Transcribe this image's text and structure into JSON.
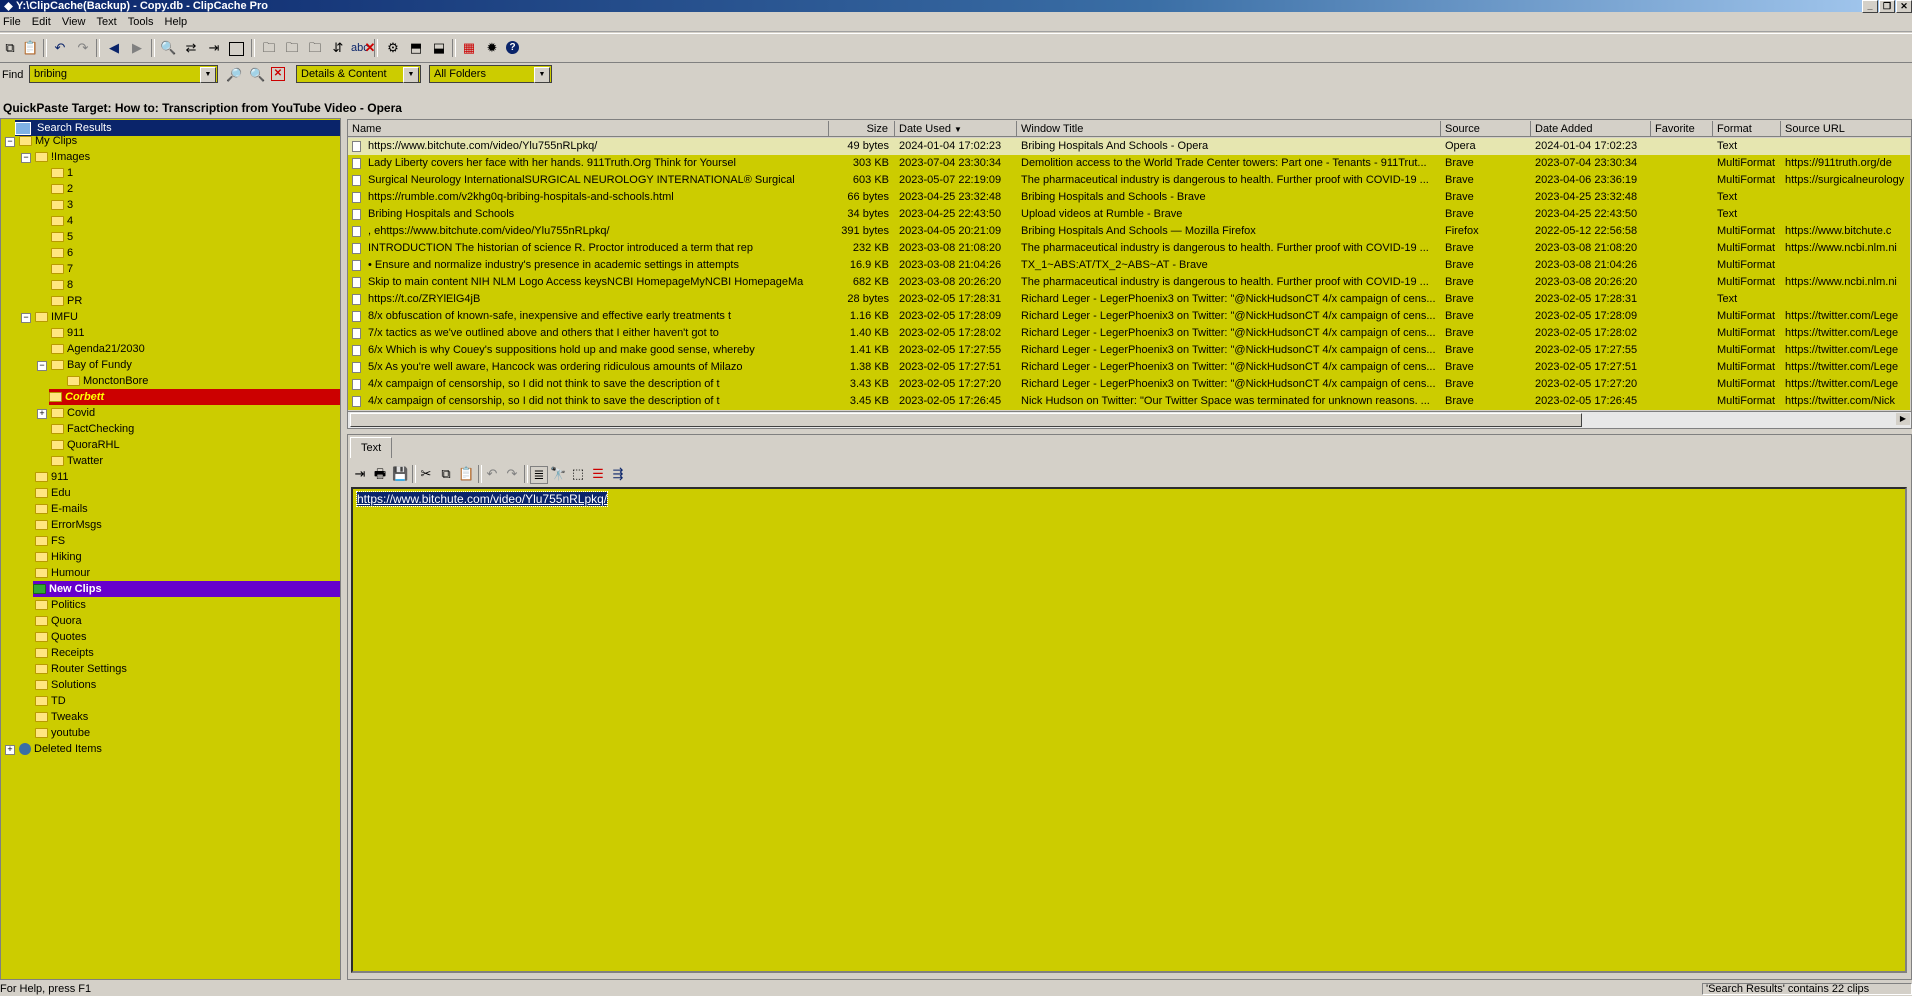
{
  "window": {
    "title": "Y:\\ClipCache(Backup) - Copy.db - ClipCache Pro",
    "controls": [
      "_",
      "❐",
      "✕"
    ]
  },
  "menu": [
    "File",
    "Edit",
    "View",
    "Text",
    "Tools",
    "Help"
  ],
  "find": {
    "label": "Find",
    "query": "bribing",
    "mode": "Details & Content",
    "folder": "All Folders"
  },
  "quickpaste": "QuickPaste Target: How to: Transcription from YouTube Video - Opera",
  "tree": {
    "search_results": "Search Results",
    "my_clips": "My Clips",
    "images": "!Images",
    "image_sub": [
      "1",
      "2",
      "3",
      "4",
      "5",
      "6",
      "7",
      "8",
      "PR"
    ],
    "imfu": "IMFU",
    "imfu_sub": [
      "911",
      "Agenda21/2030",
      "Bay of Fundy"
    ],
    "moncton": "MonctonBore",
    "corbett": "Corbett",
    "imfu_sub2": [
      "Covid",
      "FactChecking",
      "QuoraRHL",
      "Twatter"
    ],
    "top": [
      "911",
      "Edu",
      "E-mails",
      "ErrorMsgs",
      "FS",
      "Hiking",
      "Humour"
    ],
    "new_clips": "New Clips",
    "top2": [
      "Politics",
      "Quora",
      "Quotes",
      "Receipts",
      "Router Settings",
      "Solutions",
      "TD",
      "Tweaks",
      "youtube"
    ],
    "deleted": "Deleted Items"
  },
  "columns": {
    "name": "Name",
    "size": "Size",
    "date_used": "Date Used",
    "window_title": "Window Title",
    "source": "Source",
    "date_added": "Date Added",
    "favorite": "Favorite",
    "format": "Format",
    "source_url": "Source URL"
  },
  "clips": [
    {
      "name": "https://www.bitchute.com/video/Ylu755nRLpkq/",
      "size": "49 bytes",
      "used": "2024-01-04 17:02:23",
      "title": "Bribing Hospitals And Schools - Opera",
      "source": "Opera",
      "added": "2024-01-04 17:02:23",
      "format": "Text",
      "url": ""
    },
    {
      "name": "Lady Liberty covers her face with her hands. 911Truth.Org Think for Yoursel",
      "size": "303 KB",
      "used": "2023-07-04 23:30:34",
      "title": "Demolition access to the World Trade Center towers: Part one - Tenants - 911Trut...",
      "source": "Brave",
      "added": "2023-07-04 23:30:34",
      "format": "MultiFormat",
      "url": "https://911truth.org/de"
    },
    {
      "name": "Surgical Neurology InternationalSURGICAL NEUROLOGY INTERNATIONAL® Surgical",
      "size": "603 KB",
      "used": "2023-05-07 22:19:09",
      "title": "The pharmaceutical industry is dangerous to health. Further proof with COVID-19 ...",
      "source": "Brave",
      "added": "2023-04-06 23:36:19",
      "format": "MultiFormat",
      "url": "https://surgicalneurology"
    },
    {
      "name": "https://rumble.com/v2khg0q-bribing-hospitals-and-schools.html",
      "size": "66 bytes",
      "used": "2023-04-25 23:32:48",
      "title": "Bribing Hospitals and Schools - Brave",
      "source": "Brave",
      "added": "2023-04-25 23:32:48",
      "format": "Text",
      "url": ""
    },
    {
      "name": "Bribing Hospitals and Schools",
      "size": "34 bytes",
      "used": "2023-04-25 22:43:50",
      "title": "Upload videos at Rumble - Brave",
      "source": "Brave",
      "added": "2023-04-25 22:43:50",
      "format": "Text",
      "url": ""
    },
    {
      "name": ", ehttps://www.bitchute.com/video/Ylu755nRLpkq/",
      "size": "391 bytes",
      "used": "2023-04-05 20:21:09",
      "title": "Bribing Hospitals And Schools — Mozilla Firefox",
      "source": "Firefox",
      "added": "2022-05-12 22:56:58",
      "format": "MultiFormat",
      "url": "https://www.bitchute.c"
    },
    {
      "name": "INTRODUCTION The historian of science R. Proctor introduced a term that rep",
      "size": "232 KB",
      "used": "2023-03-08 21:08:20",
      "title": "The pharmaceutical industry is dangerous to health. Further proof with COVID-19 ...",
      "source": "Brave",
      "added": "2023-03-08 21:08:20",
      "format": "MultiFormat",
      "url": "https://www.ncbi.nlm.ni"
    },
    {
      "name": "• Ensure and normalize industry's presence in academic settings in attempts",
      "size": "16.9 KB",
      "used": "2023-03-08 21:04:26",
      "title": "TX_1~ABS:AT/TX_2~ABS~AT - Brave",
      "source": "Brave",
      "added": "2023-03-08 21:04:26",
      "format": "MultiFormat",
      "url": ""
    },
    {
      "name": "Skip to main content NIH NLM Logo Access keysNCBI HomepageMyNCBI HomepageMa",
      "size": "682 KB",
      "used": "2023-03-08 20:26:20",
      "title": "The pharmaceutical industry is dangerous to health. Further proof with COVID-19 ...",
      "source": "Brave",
      "added": "2023-03-08 20:26:20",
      "format": "MultiFormat",
      "url": "https://www.ncbi.nlm.ni"
    },
    {
      "name": "https://t.co/ZRYlElG4jB",
      "size": "28 bytes",
      "used": "2023-02-05 17:28:31",
      "title": "Richard Leger - LegerPhoenix3 on Twitter: \"@NickHudsonCT 4/x campaign of cens...",
      "source": "Brave",
      "added": "2023-02-05 17:28:31",
      "format": "Text",
      "url": ""
    },
    {
      "name": "8/x obfuscation of known-safe, inexpensive and effective early treatments t",
      "size": "1.16 KB",
      "used": "2023-02-05 17:28:09",
      "title": "Richard Leger - LegerPhoenix3 on Twitter: \"@NickHudsonCT 4/x campaign of cens...",
      "source": "Brave",
      "added": "2023-02-05 17:28:09",
      "format": "MultiFormat",
      "url": "https://twitter.com/Lege"
    },
    {
      "name": "7/x tactics as we've outlined above and others that I either haven't got to",
      "size": "1.40 KB",
      "used": "2023-02-05 17:28:02",
      "title": "Richard Leger - LegerPhoenix3 on Twitter: \"@NickHudsonCT 4/x campaign of cens...",
      "source": "Brave",
      "added": "2023-02-05 17:28:02",
      "format": "MultiFormat",
      "url": "https://twitter.com/Lege"
    },
    {
      "name": "6/x Which is why Couey's suppositions hold up and make good sense, whereby",
      "size": "1.41 KB",
      "used": "2023-02-05 17:27:55",
      "title": "Richard Leger - LegerPhoenix3 on Twitter: \"@NickHudsonCT 4/x campaign of cens...",
      "source": "Brave",
      "added": "2023-02-05 17:27:55",
      "format": "MultiFormat",
      "url": "https://twitter.com/Lege"
    },
    {
      "name": "5/x As you're well aware, Hancock was ordering ridiculous amounts of Milazo",
      "size": "1.38 KB",
      "used": "2023-02-05 17:27:51",
      "title": "Richard Leger - LegerPhoenix3 on Twitter: \"@NickHudsonCT 4/x campaign of cens...",
      "source": "Brave",
      "added": "2023-02-05 17:27:51",
      "format": "MultiFormat",
      "url": "https://twitter.com/Lege"
    },
    {
      "name": "4/x campaign of censorship, so I did not think to save the description of t",
      "size": "3.43 KB",
      "used": "2023-02-05 17:27:20",
      "title": "Richard Leger - LegerPhoenix3 on Twitter: \"@NickHudsonCT 4/x campaign of cens...",
      "source": "Brave",
      "added": "2023-02-05 17:27:20",
      "format": "MultiFormat",
      "url": "https://twitter.com/Lege"
    },
    {
      "name": "4/x campaign of censorship, so I did not think to save the description of t",
      "size": "3.45 KB",
      "used": "2023-02-05 17:26:45",
      "title": "Nick Hudson on Twitter: \"Our Twitter Space was terminated for unknown reasons. ...",
      "source": "Brave",
      "added": "2023-02-05 17:26:45",
      "format": "MultiFormat",
      "url": "https://twitter.com/Nick"
    }
  ],
  "detail": {
    "tab": "Text",
    "content": "https://www.bitchute.com/video/Ylu755nRLpkq/"
  },
  "status": {
    "left": "For Help, press F1",
    "right": "'Search Results' contains 22 clips"
  },
  "colors": {
    "clip_bg": "#cccc00",
    "selected_red": "#cc0000",
    "selected_purple": "#6600cc"
  }
}
